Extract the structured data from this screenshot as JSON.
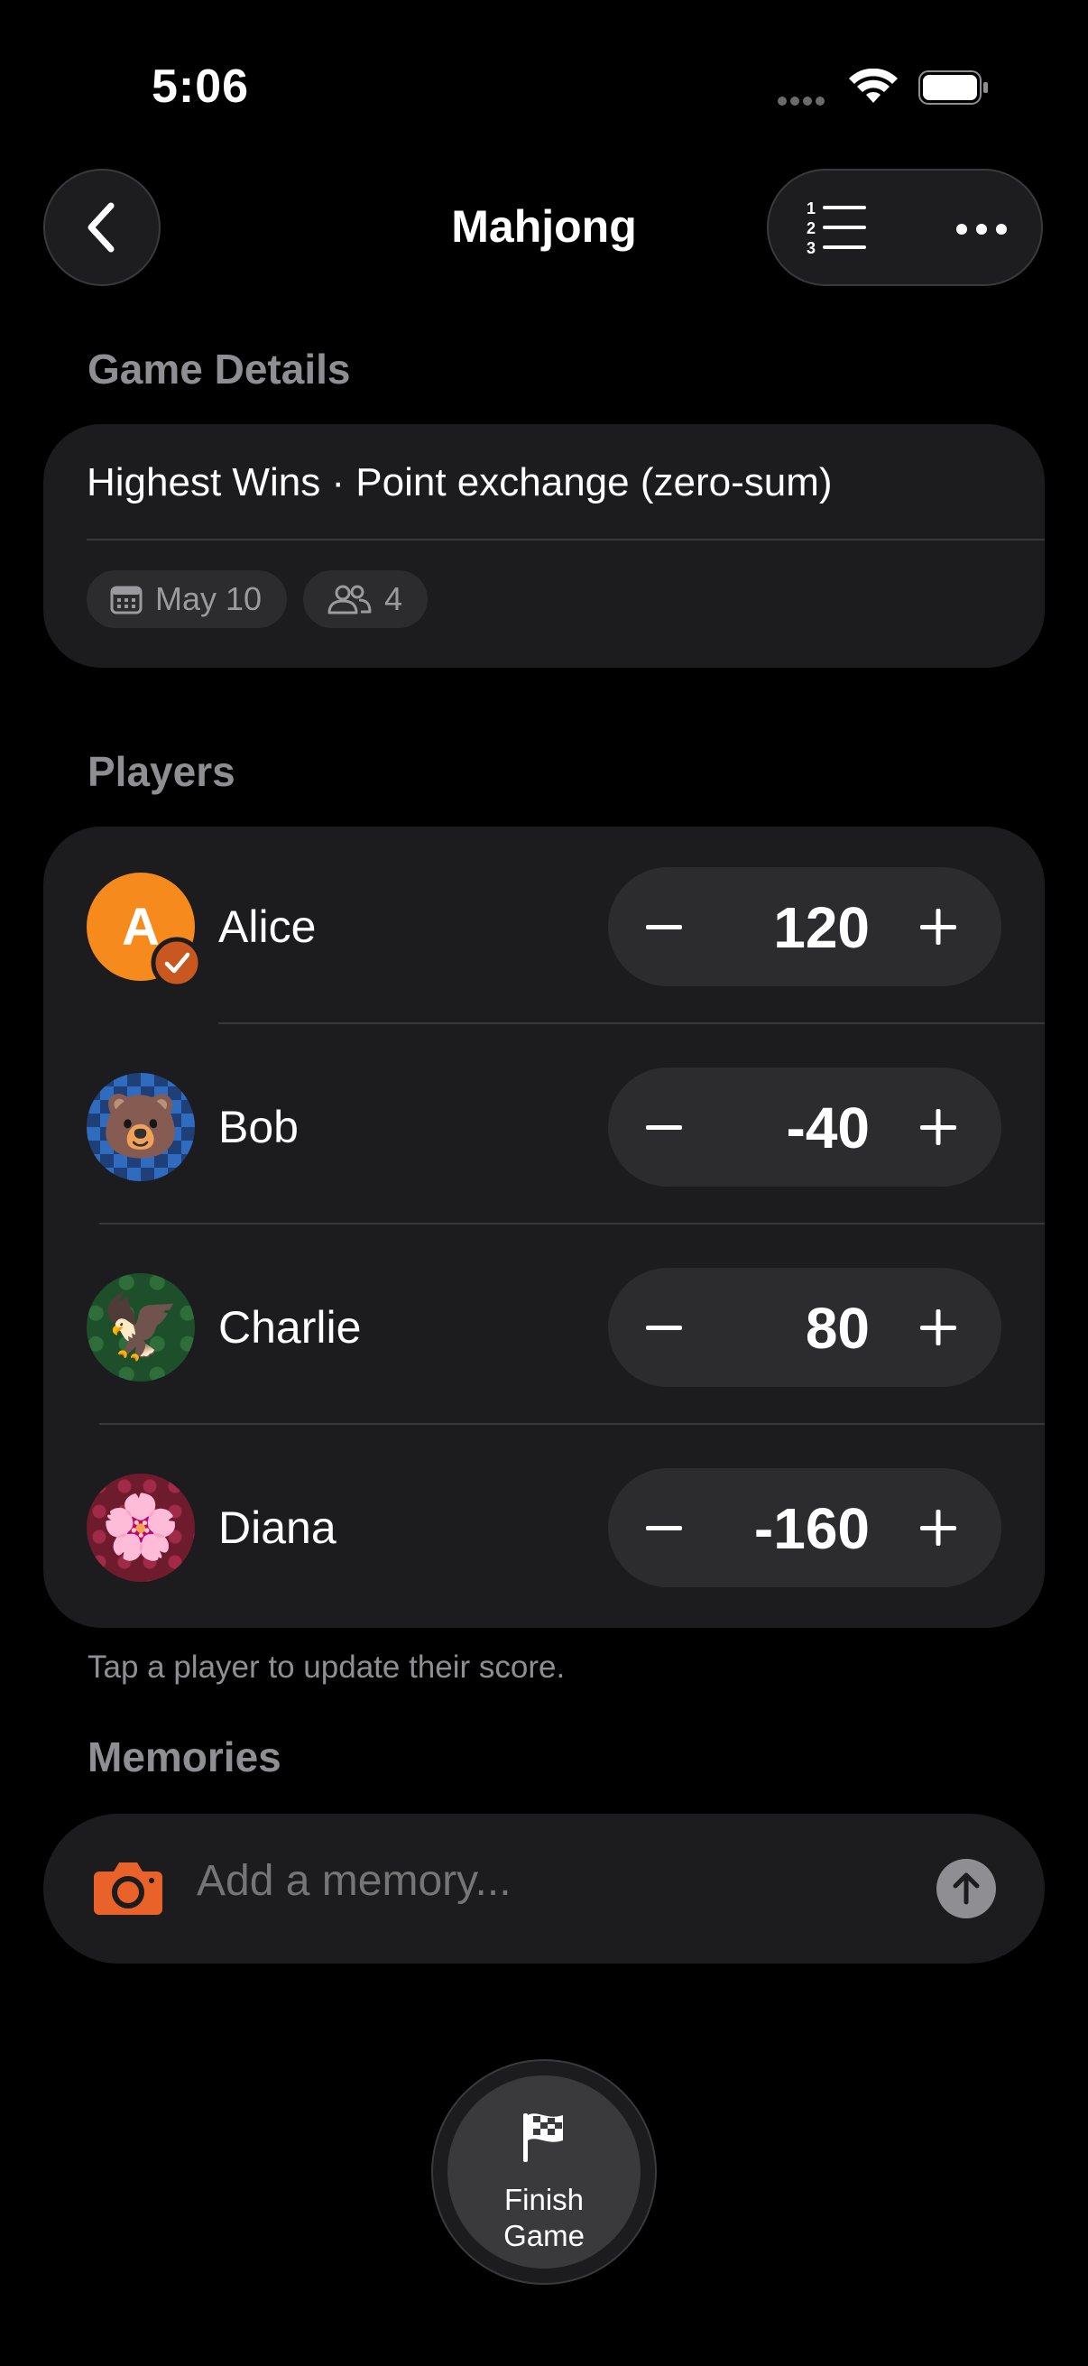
{
  "status_bar": {
    "time": "5:06"
  },
  "nav": {
    "title": "Mahjong"
  },
  "game_details": {
    "header": "Game Details",
    "summary": "Highest Wins · Point exchange (zero-sum)",
    "date": "May 10",
    "player_count": "4"
  },
  "players": {
    "header": "Players",
    "list": [
      {
        "name": "Alice",
        "score": "120",
        "avatar": "letter-a-avatar",
        "avatar_letter": "A"
      },
      {
        "name": "Bob",
        "score": "-40",
        "avatar": "bear-avatar",
        "emoji": "🐻"
      },
      {
        "name": "Charlie",
        "score": "80",
        "avatar": "eagle-avatar",
        "emoji": "🦅"
      },
      {
        "name": "Diana",
        "score": "-160",
        "avatar": "flower-avatar",
        "emoji": "🌸"
      }
    ],
    "hint": "Tap a player to update their score."
  },
  "memories": {
    "header": "Memories",
    "placeholder": "Add a memory..."
  },
  "finish": {
    "label_line1": "Finish",
    "label_line2": "Game"
  },
  "colors": {
    "accent": "#f78a1d",
    "accent_dark": "#c8581f",
    "card": "#1c1c1e",
    "stepper": "#2c2c2e"
  }
}
